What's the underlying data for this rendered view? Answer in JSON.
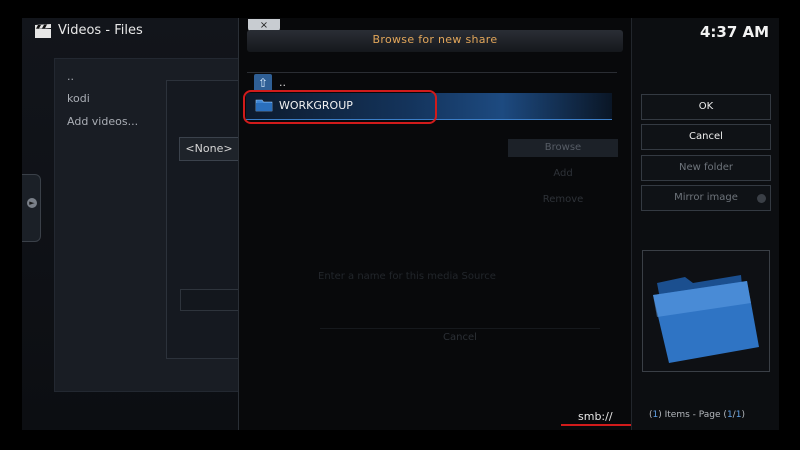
{
  "header": {
    "section": "Videos",
    "separator": "-",
    "subsection": "Files",
    "clock": "4:37 AM"
  },
  "library": {
    "items": [
      {
        "label": ".."
      },
      {
        "label": "kodi"
      },
      {
        "label": "Add videos..."
      }
    ],
    "share_dialog_button": "<None>"
  },
  "browse_dialog": {
    "close_label": "×",
    "title": "Browse for new share",
    "rows": [
      {
        "label": "..",
        "icon": "up-arrow-icon"
      },
      {
        "label": "WORKGROUP",
        "icon": "folder-icon",
        "selected": true
      }
    ],
    "path": "smb://",
    "ghost": {
      "browse": "Browse",
      "add": "Add",
      "remove": "Remove",
      "hint": "Enter a name for this media Source",
      "cancel": "Cancel"
    }
  },
  "right_panel": {
    "buttons": [
      {
        "label": "OK",
        "enabled": true
      },
      {
        "label": "Cancel",
        "enabled": true
      },
      {
        "label": "New folder",
        "enabled": false
      },
      {
        "label": "Mirror image",
        "enabled": false
      }
    ],
    "items_count": "1",
    "items_label": "Items - Page",
    "page_current": "1",
    "page_total": "1"
  },
  "colors": {
    "accent_title": "#e2a65a",
    "selection": "#1d4a80",
    "highlight_ring": "#d11b1b",
    "count_highlight": "#5fa0e6"
  }
}
